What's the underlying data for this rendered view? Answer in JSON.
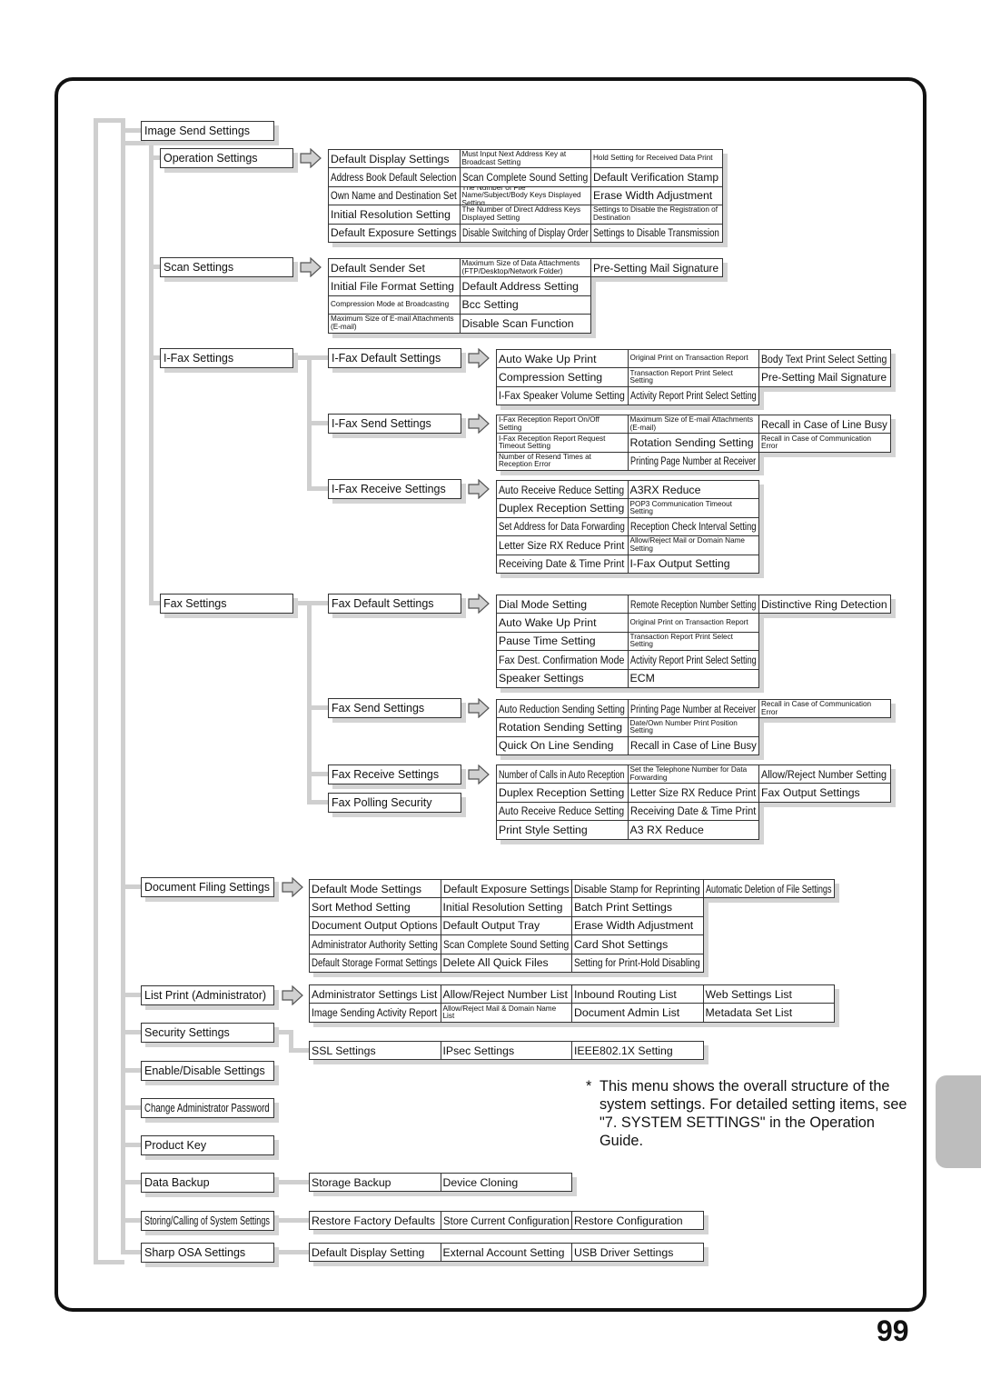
{
  "page_number": "99",
  "note": {
    "marker": "*",
    "text": "This menu shows the overall structure of the system settings. For detailed setting items, see \"7. SYSTEM SETTINGS\" in the Operation Guide."
  },
  "colors": {
    "connector": "#cfcfcf",
    "shadow": "#d4d4d4",
    "tab": "#bdbdbd"
  },
  "icons": {
    "arrow": "right-arrow-icon"
  },
  "nodes": {
    "image_send": "Image Send Settings",
    "operation": "Operation Settings",
    "scan": "Scan Settings",
    "ifax": "I-Fax Settings",
    "ifax_default": "I-Fax Default Settings",
    "ifax_send": "I-Fax Send Settings",
    "ifax_receive": "I-Fax Receive Settings",
    "fax": "Fax Settings",
    "fax_default": "Fax Default Settings",
    "fax_send": "Fax Send Settings",
    "fax_receive": "Fax Receive Settings",
    "fax_polling": "Fax Polling Security",
    "doc_filing": "Document Filing Settings",
    "list_print": "List Print (Administrator)",
    "security": "Security Settings",
    "enable_disable": "Enable/Disable Settings",
    "change_password": "Change Administrator Password",
    "product_key": "Product Key",
    "data_backup": "Data Backup",
    "storing": "Storing/Calling of System Settings",
    "sharp_osa": "Sharp OSA Settings"
  },
  "tables": {
    "operation": [
      [
        "Default Display Settings",
        "Must Input Next Address Key at Broadcast Setting",
        "Hold Setting for Received Data Print"
      ],
      [
        "Address Book Default Selection",
        "Scan Complete Sound Setting",
        "Default Verification Stamp"
      ],
      [
        "Own Name and Destination Set",
        "The Number of File Name/Subject/Body Keys Displayed Setting",
        "Erase Width Adjustment"
      ],
      [
        "Initial Resolution Setting",
        "The Number of Direct Address Keys Displayed Setting",
        "Settings to Disable the Registration of Destination"
      ],
      [
        "Default Exposure Settings",
        "Disable Switching of Display Order",
        "Settings to Disable Transmission"
      ]
    ],
    "scan": [
      [
        "Default Sender Set",
        "Maximum Size of Data Attachments (FTP/Desktop/Network Folder)",
        "Pre-Setting Mail Signature"
      ],
      [
        "Initial File Format Setting",
        "Default Address Setting"
      ],
      [
        "Compression Mode at Broadcasting",
        "Bcc Setting"
      ],
      [
        "Maximum Size of E-mail Attachments (E-mail)",
        "Disable Scan Function"
      ]
    ],
    "ifax_default": [
      [
        "Auto Wake Up Print",
        "Original Print on Transaction Report",
        "Body Text Print Select Setting"
      ],
      [
        "Compression Setting",
        "Transaction Report Print Select Setting",
        "Pre-Setting Mail Signature"
      ],
      [
        "I-Fax Speaker Volume Setting",
        "Activity Report Print Select Setting"
      ]
    ],
    "ifax_send": [
      [
        "I-Fax Reception Report On/Off Setting",
        "Maximum Size of E-mail Attachments (E-mail)",
        "Recall in Case of Line Busy"
      ],
      [
        "I-Fax Reception Report Request Timeout Setting",
        "Rotation Sending Setting",
        "Recall in Case of Communication Error"
      ],
      [
        "Number of Resend Times at Reception Error",
        "Printing Page Number at Receiver"
      ]
    ],
    "ifax_receive": [
      [
        "Auto Receive Reduce Setting",
        "A3RX Reduce"
      ],
      [
        "Duplex Reception Setting",
        "POP3 Communication Timeout Setting"
      ],
      [
        "Set Address for Data Forwarding",
        "Reception Check Interval Setting"
      ],
      [
        "Letter Size RX Reduce Print",
        "Allow/Reject Mail or Domain Name Setting"
      ],
      [
        "Receiving Date & Time Print",
        "I-Fax Output Setting"
      ]
    ],
    "fax_default": [
      [
        "Dial Mode Setting",
        "Remote Reception Number Setting",
        "Distinctive Ring Detection"
      ],
      [
        "Auto Wake Up Print",
        "Original Print on Transaction Report"
      ],
      [
        "Pause Time Setting",
        "Transaction Report Print Select Setting"
      ],
      [
        "Fax Dest. Confirmation Mode",
        "Activity Report Print Select Setting"
      ],
      [
        "Speaker Settings",
        "ECM"
      ]
    ],
    "fax_send": [
      [
        "Auto Reduction Sending Setting",
        "Printing Page Number at Receiver",
        "Recall in Case of Communication Error"
      ],
      [
        "Rotation Sending Setting",
        "Date/Own Number Print Position Setting"
      ],
      [
        "Quick On Line Sending",
        "Recall in Case of Line Busy"
      ]
    ],
    "fax_receive": [
      [
        "Number of Calls in Auto Reception",
        "Set the Telephone Number for Data Forwarding",
        "Allow/Reject Number Setting"
      ],
      [
        "Duplex Reception Setting",
        "Letter Size RX Reduce Print",
        "Fax Output Settings"
      ],
      [
        "Auto Receive Reduce Setting",
        "Receiving Date & Time Print"
      ],
      [
        "Print Style Setting",
        "A3 RX Reduce"
      ]
    ],
    "doc_filing": [
      [
        "Default Mode Settings",
        "Default Exposure Settings",
        "Disable Stamp for Reprinting",
        "Automatic Deletion of File Settings"
      ],
      [
        "Sort Method Setting",
        "Initial Resolution Setting",
        "Batch Print Settings"
      ],
      [
        "Document Output Options",
        "Default Output Tray",
        "Erase Width Adjustment"
      ],
      [
        "Administrator Authority Setting",
        "Scan Complete Sound Setting",
        "Card Shot Settings"
      ],
      [
        "Default Storage Format Settings",
        "Delete All Quick Files",
        "Setting for Print-Hold Disabling"
      ]
    ],
    "list_print": [
      [
        "Administrator Settings List",
        "Allow/Reject Number List",
        "Inbound Routing List",
        "Web Settings List"
      ],
      [
        "Image Sending Activity Report",
        "Allow/Reject Mail & Domain Name List",
        "Document Admin List",
        "Metadata Set List"
      ]
    ],
    "security": [
      [
        "SSL Settings",
        "IPsec Settings",
        "IEEE802.1X Setting"
      ]
    ],
    "data_backup": [
      [
        "Storage Backup",
        "Device Cloning"
      ]
    ],
    "storing": [
      [
        "Restore Factory Defaults",
        "Store Current Configuration",
        "Restore Configuration"
      ]
    ],
    "sharp_osa": [
      [
        "Default Display Setting",
        "External Account Setting",
        "USB Driver Settings"
      ]
    ]
  }
}
